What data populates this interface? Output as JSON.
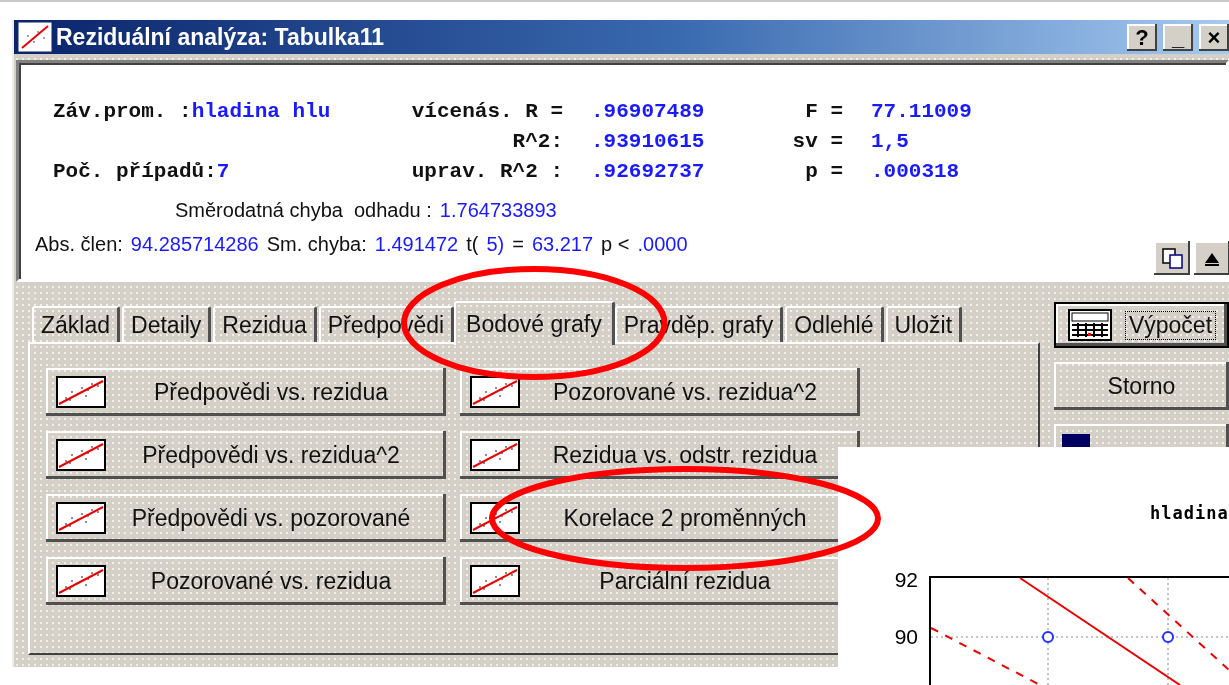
{
  "window": {
    "title": "Reziduální analýza: Tabulka11",
    "title_buttons": [
      "?",
      "_",
      "×"
    ]
  },
  "summary": {
    "rows": [
      {
        "lead": [
          {
            "text": "Záv.prom. :",
            "kind": "label"
          },
          {
            "text": "hladina hlu",
            "kind": "value"
          }
        ],
        "stat": {
          "label": "vícenás. R =",
          "value": ".96907489"
        },
        "test": {
          "label": "F =",
          "value": "77.11009"
        }
      },
      {
        "stat": {
          "label": "R^2:",
          "value": ".93910615"
        },
        "test": {
          "label": "sv =",
          "value": "1,5"
        }
      },
      {
        "lead": [
          {
            "text": "Poč. případů:",
            "kind": "label"
          },
          {
            "text": "7",
            "kind": "value"
          }
        ],
        "stat": {
          "label": "uprav. R^2 :",
          "value": ".92692737"
        },
        "test": {
          "label": "p =",
          "value": ".000318"
        }
      }
    ],
    "lines": [
      {
        "segments": [
          {
            "text": "Směrodatná chyba  odhadu :",
            "kind": "label"
          },
          {
            "text": "1.764733893",
            "kind": "value"
          }
        ]
      },
      {
        "segments": [
          {
            "text": "Abs. člen:",
            "kind": "label"
          },
          {
            "text": "94.285714286",
            "kind": "value"
          },
          {
            "text": "Sm. chyba:",
            "kind": "label"
          },
          {
            "text": "1.491472",
            "kind": "value"
          },
          {
            "text": "t(",
            "kind": "label"
          },
          {
            "text": "5)",
            "kind": "value"
          },
          {
            "text": "=",
            "kind": "label"
          },
          {
            "text": "63.217",
            "kind": "value"
          },
          {
            "text": "p <",
            "kind": "label"
          },
          {
            "text": ".0000",
            "kind": "value"
          }
        ]
      }
    ]
  },
  "pane_buttons": [
    {
      "kind": "copy"
    },
    {
      "kind": "up"
    }
  ],
  "tabs": [
    {
      "label": "Základ",
      "selected": false,
      "circled": false
    },
    {
      "label": "Detaily",
      "selected": false,
      "circled": false
    },
    {
      "label": "Rezidua",
      "selected": false,
      "circled": false
    },
    {
      "label": "Předpovědi",
      "selected": false,
      "circled": false
    },
    {
      "label": "Bodové grafy",
      "selected": true,
      "circled": true
    },
    {
      "label": "Pravděp. grafy",
      "selected": false,
      "circled": false
    },
    {
      "label": "Odlehlé",
      "selected": false,
      "circled": false
    },
    {
      "label": "Uložit",
      "selected": false,
      "circled": false
    }
  ],
  "plot_buttons": [
    {
      "label": "Předpovědi vs. rezidua",
      "circled": false
    },
    {
      "label": "Pozorované vs. rezidua^2",
      "circled": false
    },
    {
      "label": "Předpovědi vs. rezidua^2",
      "circled": false
    },
    {
      "label": "Rezidua vs. odstr. rezidua",
      "circled": false
    },
    {
      "label": "Předpovědi vs. pozorované",
      "circled": false
    },
    {
      "label": "Korelace 2 proměnných",
      "circled": true
    },
    {
      "label": "Pozorované vs. rezidua",
      "circled": false
    },
    {
      "label": "Parciální rezidua",
      "circled": false
    }
  ],
  "side_buttons": [
    {
      "label": "Výpočet",
      "default": true,
      "kind": "calculator"
    },
    {
      "label": "Storno",
      "default": false
    },
    {
      "default": false,
      "kind": "square"
    }
  ],
  "chart_window": {
    "title": "hladina",
    "y_tick_labels": [
      "92",
      "90"
    ]
  }
}
